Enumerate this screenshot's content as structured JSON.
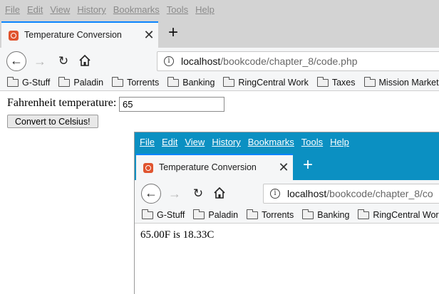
{
  "menu": [
    "File",
    "Edit",
    "View",
    "History",
    "Bookmarks",
    "Tools",
    "Help"
  ],
  "tab": {
    "title": "Temperature Conversion",
    "close": "✕",
    "new": "+"
  },
  "nav": {
    "back": "←",
    "forward": "→",
    "reload": "↻",
    "info": "i"
  },
  "url": {
    "host": "localhost",
    "path": "/bookcode/chapter_8/code.php"
  },
  "url2": {
    "host": "localhost",
    "path": "/bookcode/chapter_8/co"
  },
  "bookmarks": [
    "G-Stuff",
    "Paladin",
    "Torrents",
    "Banking",
    "RingCentral Work",
    "Taxes",
    "Mission Marketing"
  ],
  "bookmarks2": [
    "G-Stuff",
    "Paladin",
    "Torrents",
    "Banking",
    "RingCentral Work"
  ],
  "form": {
    "label": "Fahrenheit temperature:",
    "value": "65",
    "button": "Convert to Celsius!"
  },
  "result": "65.00F is 18.33C",
  "colors": {
    "active_menubar": "#0b90c2",
    "inactive_menubar": "#d3d3d3",
    "tab_accent": "#0a84ff"
  }
}
